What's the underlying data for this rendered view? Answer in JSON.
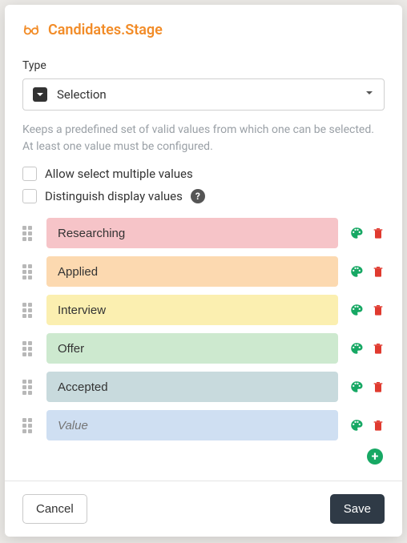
{
  "header": {
    "title": "Candidates.Stage"
  },
  "type_section": {
    "label": "Type",
    "selected": "Selection",
    "helper": "Keeps a predefined set of valid values from which one can be selected. At least one value must be configured."
  },
  "options": {
    "allow_multiple": {
      "label": "Allow select multiple values",
      "checked": false
    },
    "distinguish_display": {
      "label": "Distinguish display values",
      "checked": false
    }
  },
  "values": [
    {
      "label": "Researching",
      "bg": "#f6c4c8",
      "placeholder": false
    },
    {
      "label": "Applied",
      "bg": "#fcd9b0",
      "placeholder": false
    },
    {
      "label": "Interview",
      "bg": "#fbefb0",
      "placeholder": false
    },
    {
      "label": "Offer",
      "bg": "#cde9cf",
      "placeholder": false
    },
    {
      "label": "Accepted",
      "bg": "#c8dadd",
      "placeholder": false
    },
    {
      "label": "Value",
      "bg": "#cfdff2",
      "placeholder": true
    }
  ],
  "footer": {
    "cancel": "Cancel",
    "save": "Save"
  },
  "icons": {
    "header": "glasses-icon",
    "select": "dropdown-icon",
    "chevron": "chevron-down-icon",
    "help": "help-icon",
    "grip": "drag-handle-icon",
    "palette": "palette-icon",
    "trash": "trash-icon",
    "add": "plus-icon"
  }
}
